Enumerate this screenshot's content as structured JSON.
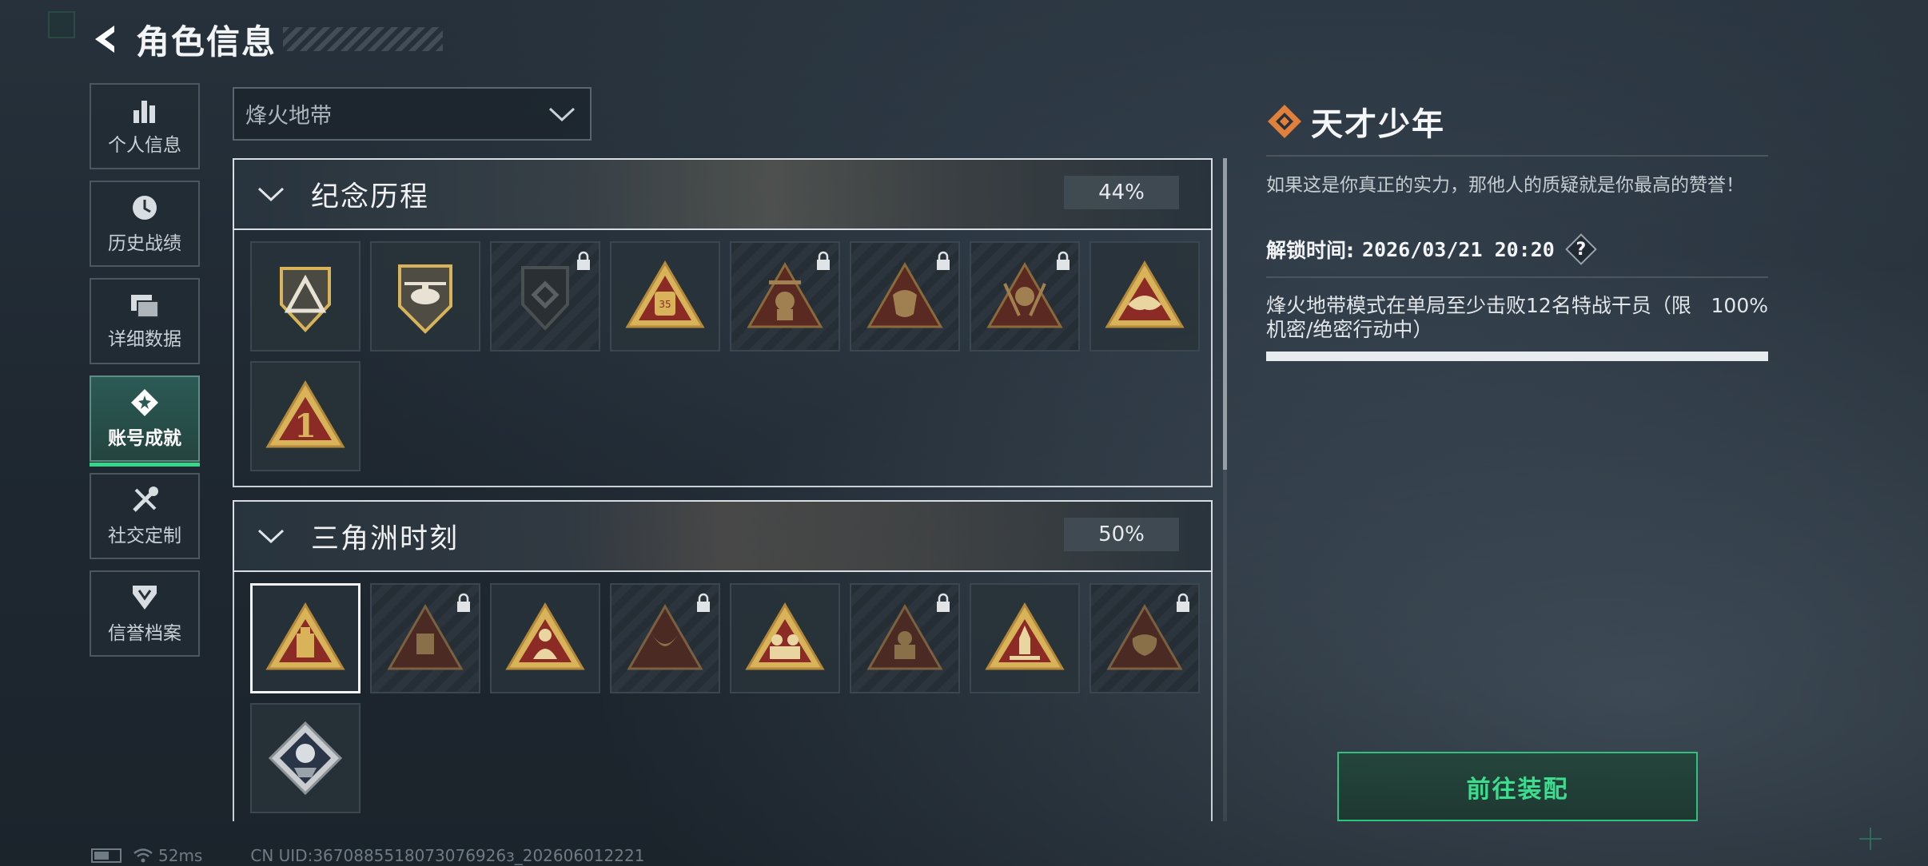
{
  "header": {
    "title": "角色信息"
  },
  "sidebar": {
    "items": [
      {
        "label": "个人信息",
        "icon": "bar-chart-icon"
      },
      {
        "label": "历史战绩",
        "icon": "history-icon"
      },
      {
        "label": "详细数据",
        "icon": "cards-icon"
      },
      {
        "label": "账号成就",
        "icon": "achievement-icon",
        "active": true
      },
      {
        "label": "社交定制",
        "icon": "tools-icon"
      },
      {
        "label": "信誉档案",
        "icon": "shield-icon"
      }
    ]
  },
  "filter": {
    "selected": "烽火地带"
  },
  "sections": [
    {
      "title": "纪念历程",
      "percent": "44%",
      "badges": [
        {
          "icon": "triangle-mountain-badge-icon",
          "locked": false
        },
        {
          "icon": "helicopter-badge-icon",
          "locked": false
        },
        {
          "icon": "shield-emblem-badge-icon",
          "locked": true
        },
        {
          "icon": "backpack-35-badge-icon",
          "locked": false
        },
        {
          "icon": "soldier-plane-badge-icon",
          "locked": true
        },
        {
          "icon": "mask-badge-icon",
          "locked": true
        },
        {
          "icon": "soldier-rifles-badge-icon",
          "locked": true
        },
        {
          "icon": "hat-badge-icon",
          "locked": false
        },
        {
          "icon": "number-one-badge-icon",
          "locked": false
        }
      ]
    },
    {
      "title": "三角洲时刻",
      "percent": "50%",
      "badges": [
        {
          "icon": "usb-drive-badge-icon",
          "locked": false,
          "selected": true
        },
        {
          "icon": "robot-badge-icon",
          "locked": true
        },
        {
          "icon": "figure-badge-icon",
          "locked": false
        },
        {
          "icon": "horns-badge-icon",
          "locked": true
        },
        {
          "icon": "team-badge-icon",
          "locked": false
        },
        {
          "icon": "warrior-badge-icon",
          "locked": true
        },
        {
          "icon": "rocket-badge-icon",
          "locked": false
        },
        {
          "icon": "fist-badge-icon",
          "locked": true
        },
        {
          "icon": "rose-badge-icon",
          "locked": false
        }
      ]
    }
  ],
  "detail": {
    "title": "天才少年",
    "description": "如果这是你真正的实力，那他人的质疑就是你最高的赞誉！",
    "unlock_label": "解锁时间:",
    "unlock_time": "2026/03/21 20:20",
    "help": "?",
    "requirement": "烽火地带模式在单局至少击败12名特战干员（限机密/绝密行动中）",
    "progress_text": "100%",
    "progress_value": 1.0
  },
  "equip_button": "前往装配",
  "status": {
    "ping": "52ms",
    "uid": "CN UID:3670885518073076926з_202606012221"
  },
  "colors": {
    "accent_green": "#35d58a",
    "badge_gold": "#d8b35a",
    "badge_red": "#8c2a26"
  }
}
